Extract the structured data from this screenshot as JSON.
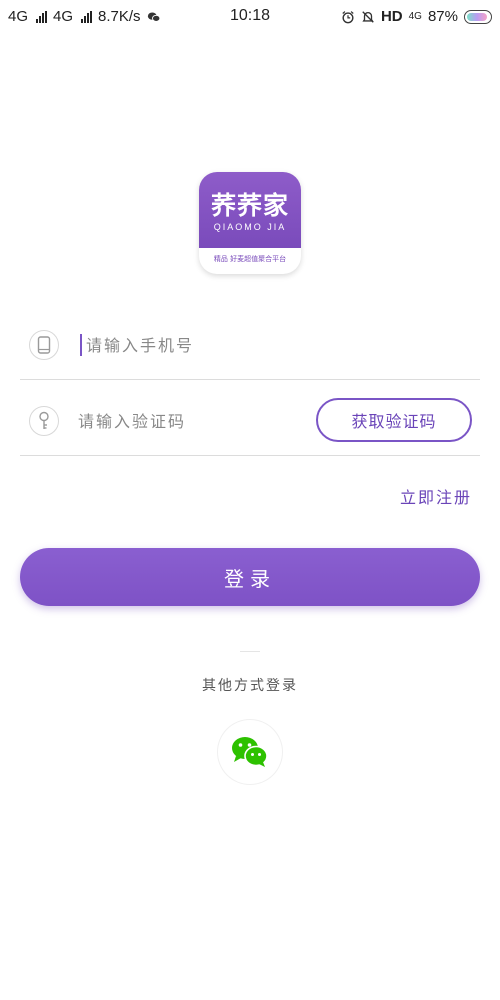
{
  "status_bar": {
    "network_1": "4G",
    "network_2": "4G",
    "speed": "8.7K/s",
    "time": "10:18",
    "hd": "HD",
    "network_3": "4G",
    "battery": "87%"
  },
  "logo": {
    "title": "荞荞家",
    "subtitle": "QIAOMO JIA",
    "tagline": "精品 好麦超值聚合平台"
  },
  "form": {
    "phone_placeholder": "请输入手机号",
    "code_placeholder": "请输入验证码",
    "get_code_label": "获取验证码",
    "register_label": "立即注册",
    "login_label": "登录"
  },
  "other_login": {
    "label": "其他方式登录"
  },
  "colors": {
    "accent": "#7a55c6",
    "wechat": "#2dc100"
  },
  "icons": [
    "phone-icon",
    "key-icon",
    "wechat-icon"
  ]
}
